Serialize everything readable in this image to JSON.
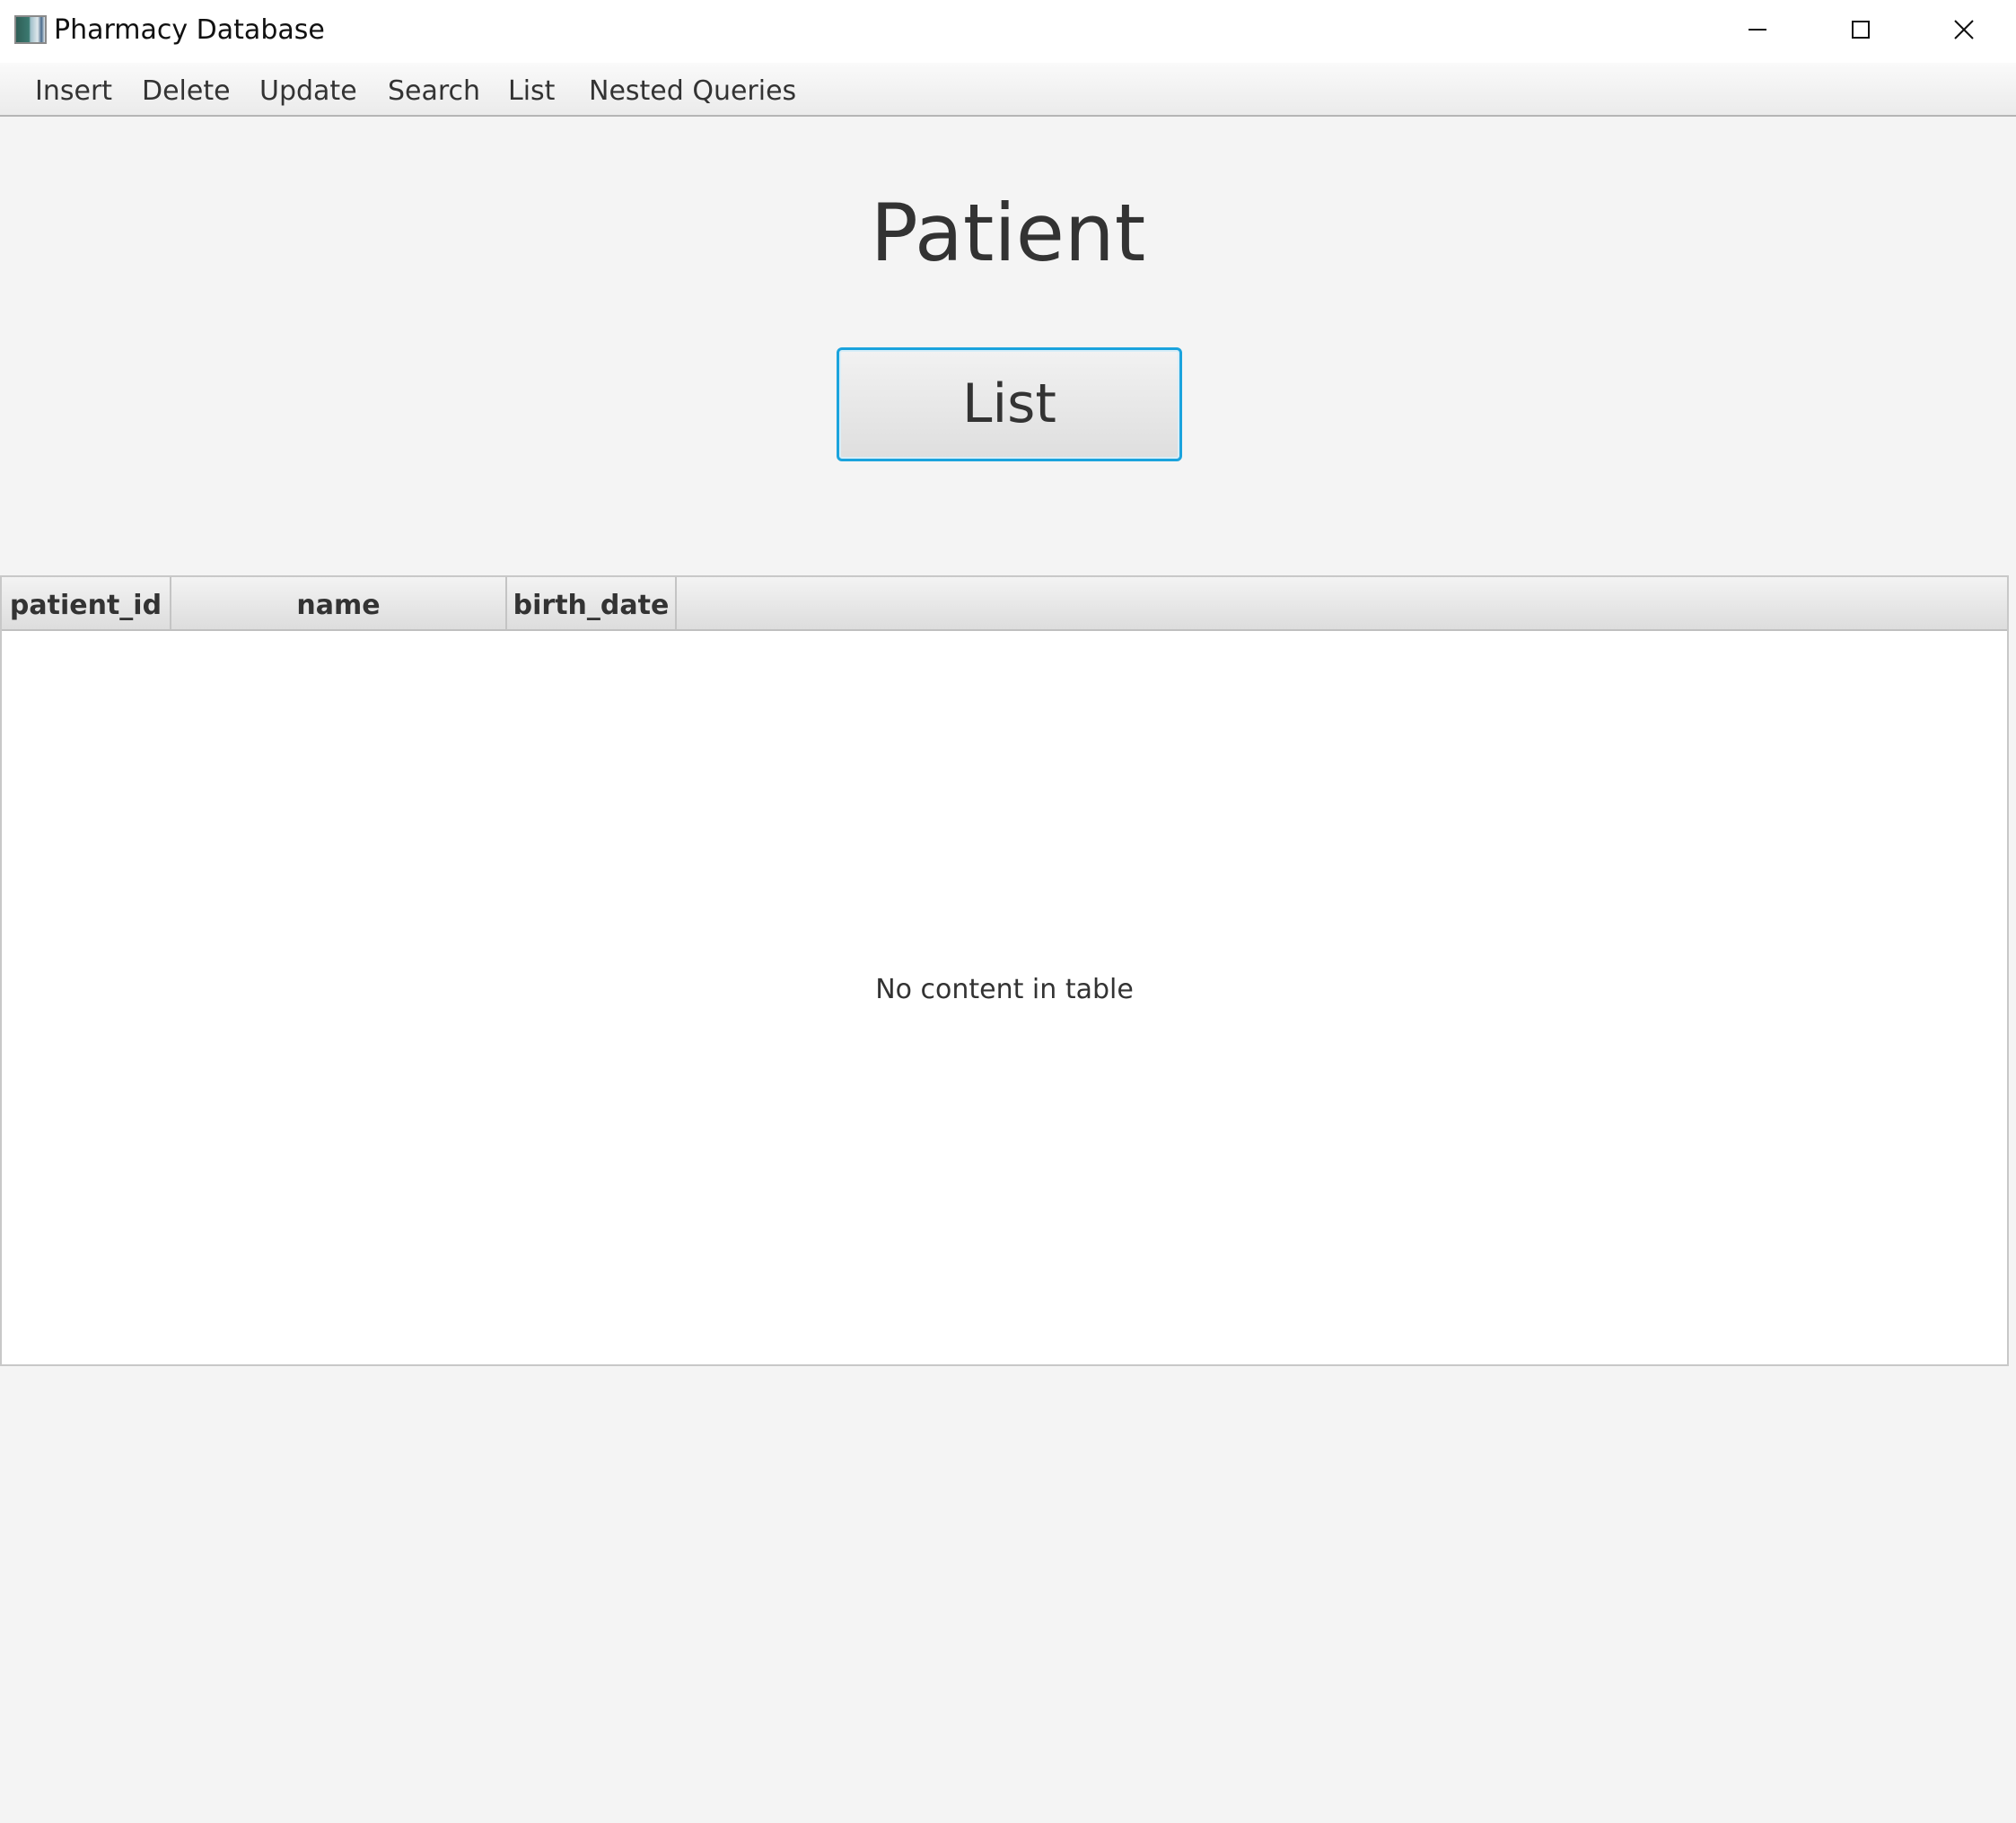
{
  "window": {
    "title": "Pharmacy Database",
    "icon": "app-icon",
    "controls": [
      "minimize-icon",
      "maximize-icon",
      "close-icon"
    ]
  },
  "menu": {
    "items": [
      "Insert",
      "Delete",
      "Update",
      "Search",
      "List",
      "Nested Queries"
    ]
  },
  "main": {
    "heading": "Patient",
    "list_button_label": "List"
  },
  "table": {
    "columns": [
      "patient_id",
      "name",
      "birth_date"
    ],
    "rows": [],
    "empty_message": "No content in table"
  },
  "colors": {
    "background": "#f4f4f4",
    "focus_border": "#1aa3dd",
    "text": "#333333"
  }
}
